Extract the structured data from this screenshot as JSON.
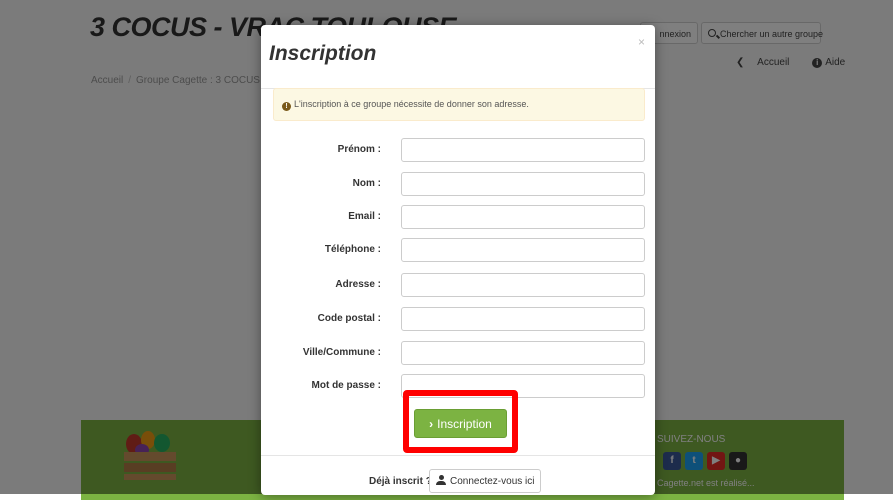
{
  "background": {
    "site_title": "3 COCUS - VRAC TOULOUSE",
    "breadcrumb": [
      "Accueil",
      "Groupe Cagette : 3 COCUS"
    ],
    "top_buttons": {
      "login": "nnexion",
      "search": "Chercher un autre groupe"
    },
    "help_links": {
      "home": "Accueil",
      "help": "Aide"
    },
    "footer": {
      "follow_label": "SUIVEZ-NOUS",
      "text": "Cagette.net est réalisé..."
    }
  },
  "modal": {
    "title": "Inscription",
    "close": "×",
    "alert": "L'inscription à ce groupe nécessite de donner son adresse.",
    "fields": [
      {
        "label": "Prénom :",
        "value": ""
      },
      {
        "label": "Nom :",
        "value": ""
      },
      {
        "label": "Email :",
        "value": ""
      },
      {
        "label": "Téléphone :",
        "value": ""
      },
      {
        "label": "Adresse :",
        "value": ""
      },
      {
        "label": "Code postal :",
        "value": ""
      },
      {
        "label": "Ville/Commune :",
        "value": ""
      },
      {
        "label": "Mot de passe :",
        "value": ""
      }
    ],
    "submit_label": "Inscription",
    "already_registered": "Déjà inscrit ?",
    "connect_label": "Connectez-vous ici"
  },
  "colors": {
    "accent_green": "#7cb342",
    "highlight": "#ff0000",
    "alert_bg": "#fcf8e3"
  }
}
